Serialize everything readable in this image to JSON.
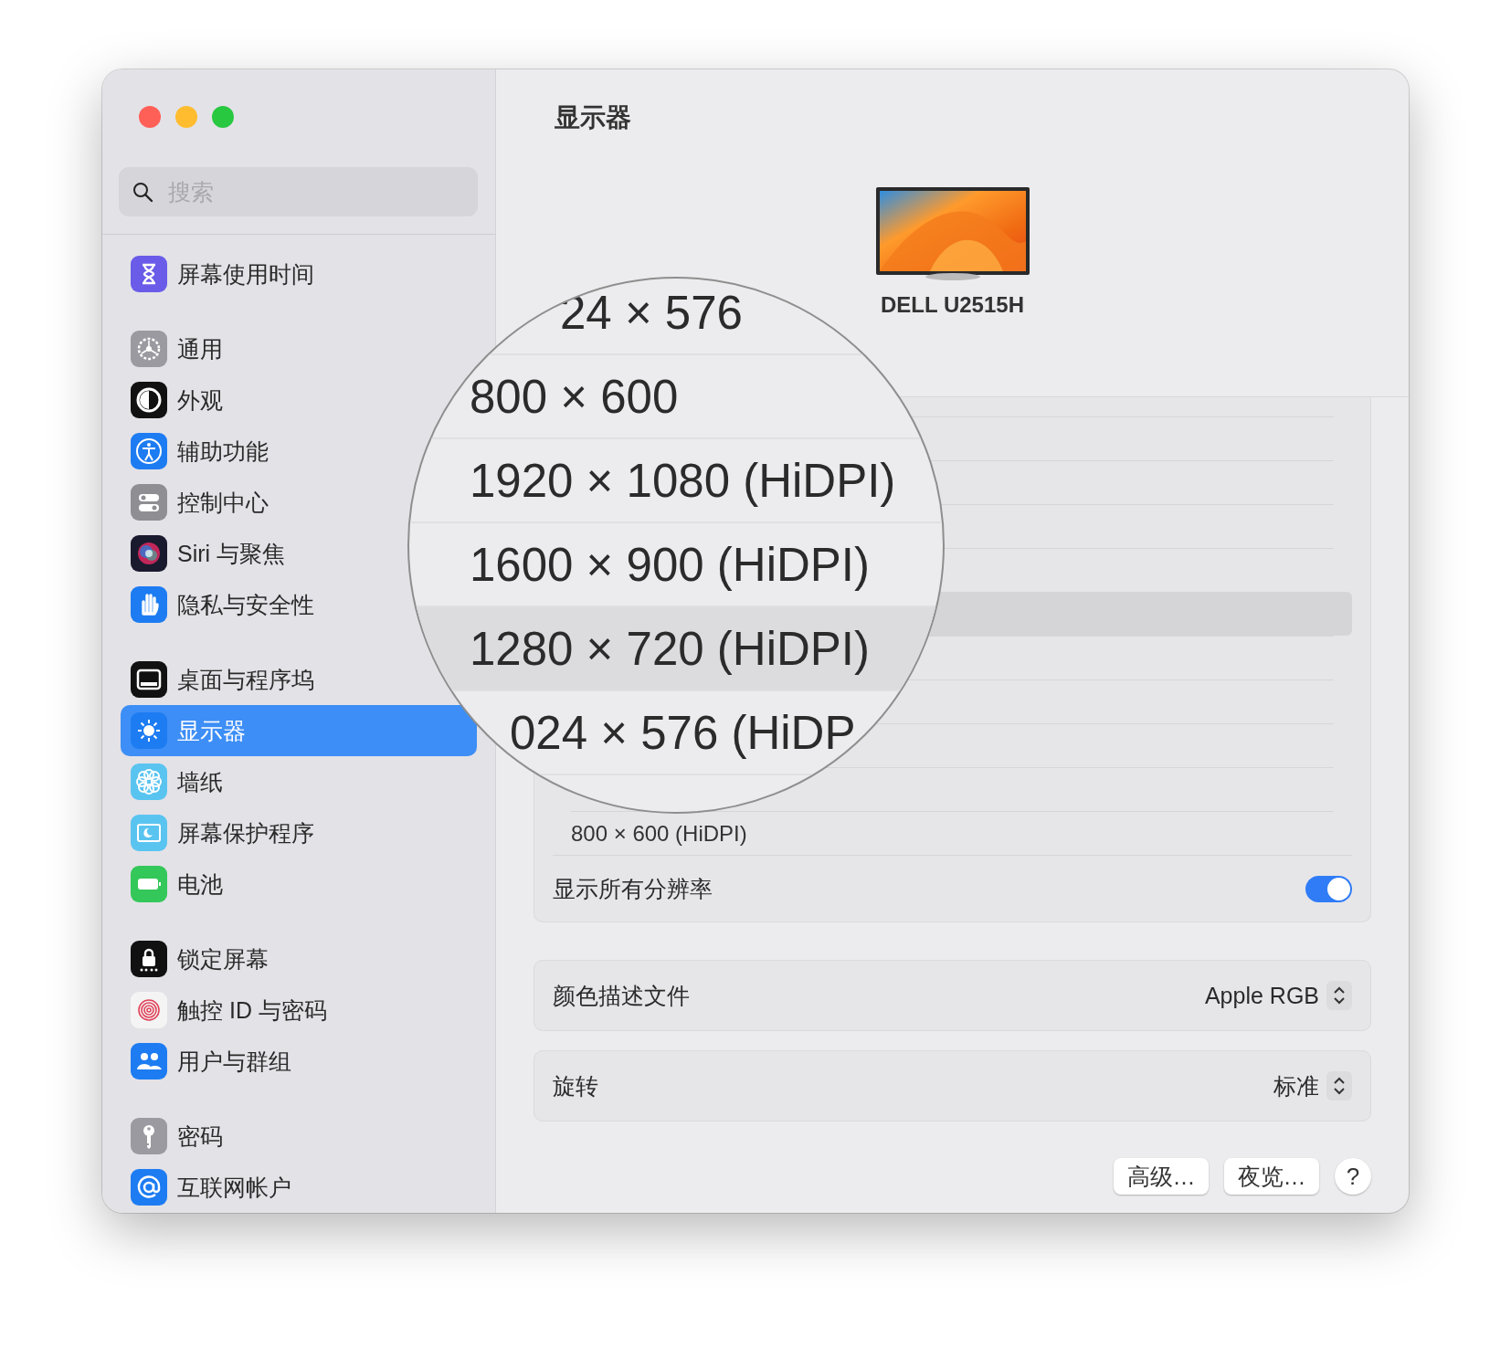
{
  "sidebar": {
    "search": {
      "placeholder": "搜索"
    },
    "groups": [
      {
        "items": [
          {
            "label": "屏幕使用时间",
            "kind": "hourglass",
            "selected": false
          }
        ]
      },
      {
        "items": [
          {
            "label": "通用",
            "kind": "gear",
            "selected": false
          },
          {
            "label": "外观",
            "kind": "appearance",
            "selected": false
          },
          {
            "label": "辅助功能",
            "kind": "accessibility",
            "selected": false
          },
          {
            "label": "控制中心",
            "kind": "switches",
            "selected": false
          },
          {
            "label": "Siri 与聚焦",
            "kind": "siri",
            "selected": false
          },
          {
            "label": "隐私与安全性",
            "kind": "hand",
            "selected": false
          }
        ]
      },
      {
        "items": [
          {
            "label": "桌面与程序坞",
            "kind": "dock",
            "selected": false
          },
          {
            "label": "显示器",
            "kind": "sun",
            "selected": true
          },
          {
            "label": "墙纸",
            "kind": "flower",
            "selected": false
          },
          {
            "label": "屏幕保护程序",
            "kind": "screensaver",
            "selected": false
          },
          {
            "label": "电池",
            "kind": "battery",
            "selected": false
          }
        ]
      },
      {
        "items": [
          {
            "label": "锁定屏幕",
            "kind": "lock",
            "selected": false
          },
          {
            "label": "触控 ID 与密码",
            "kind": "fingerprint",
            "selected": false
          },
          {
            "label": "用户与群组",
            "kind": "users",
            "selected": false
          }
        ]
      },
      {
        "items": [
          {
            "label": "密码",
            "kind": "key",
            "selected": false
          },
          {
            "label": "互联网帐户",
            "kind": "at",
            "selected": false
          }
        ]
      }
    ]
  },
  "page": {
    "title": "显示器",
    "display": {
      "name": "DELL U2515H"
    },
    "resolution_list": {
      "rows": [
        {
          "label": "800 × 600 (HiDPI)",
          "selected": false
        }
      ]
    },
    "show_all": {
      "label": "显示所有分辨率",
      "on": true
    },
    "settings": [
      {
        "label": "颜色描述文件",
        "value": "Apple RGB"
      },
      {
        "label": "旋转",
        "value": "标准"
      }
    ],
    "buttons": [
      {
        "label": "高级…",
        "kind": "text"
      },
      {
        "label": "夜览…",
        "kind": "text"
      },
      {
        "label": "?",
        "kind": "help"
      }
    ]
  },
  "magnifier": {
    "rows": [
      {
        "label": "24 × 576",
        "selected": false
      },
      {
        "label": "800 × 600",
        "selected": false
      },
      {
        "label": "1920 × 1080 (HiDPI)",
        "selected": false
      },
      {
        "label": "1600 × 900 (HiDPI)",
        "selected": false
      },
      {
        "label": "1280 × 720 (HiDPI)",
        "selected": true
      },
      {
        "label": "024 × 576 (HiDP",
        "selected": false
      }
    ]
  }
}
